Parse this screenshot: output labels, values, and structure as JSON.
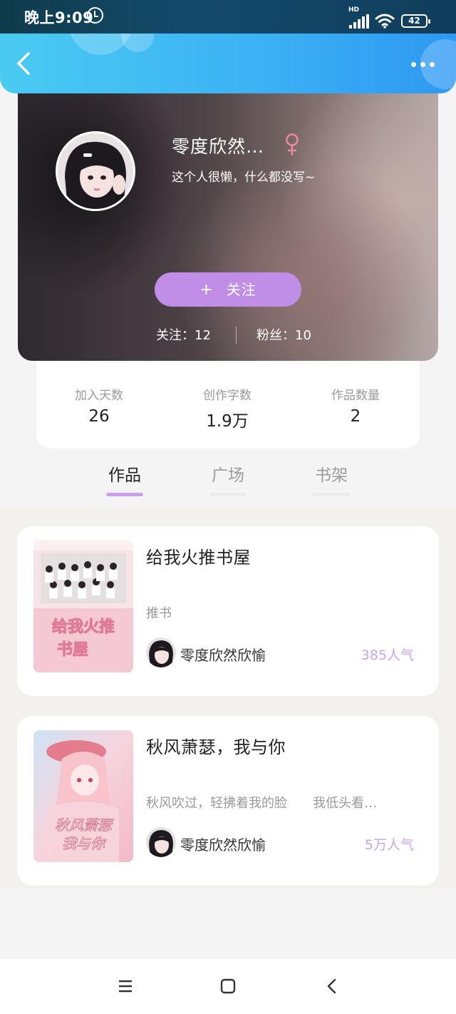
{
  "status_bar": {
    "time": "晚上9:09",
    "network": "HD",
    "battery": "42"
  },
  "profile": {
    "nickname": "零度欣然…",
    "bio": "这个人很懒，什么都没写~",
    "follow_plus": "+",
    "follow_label": "关注",
    "following_label": "关注：12",
    "followers_label": "粉丝：10"
  },
  "stats": [
    {
      "label": "加入天数",
      "value": "26"
    },
    {
      "label": "创作字数",
      "value": "1.9万"
    },
    {
      "label": "作品数量",
      "value": "2"
    }
  ],
  "tabs": [
    {
      "label": "作品",
      "active": true
    },
    {
      "label": "广场",
      "active": false
    },
    {
      "label": "书架",
      "active": false
    }
  ],
  "works": [
    {
      "title": "给我火推书屋",
      "description": "推书",
      "author": "零度欣然欣愉",
      "popularity": "385人气",
      "cover_text": "给我火推书屋"
    },
    {
      "title": "秋风萧瑟，我与你",
      "description": "秋风吹过，轻拂着我的脸　　我低头看…",
      "author": "零度欣然欣愉",
      "popularity": "5万人气",
      "cover_text": "秋风萧瑟我与你"
    }
  ],
  "colors": {
    "header_gradient_start": "#49cbf2",
    "header_gradient_end": "#2e98f2",
    "accent_purple": "#c08ee6",
    "popularity_purple": "#c9a6eb"
  },
  "icons": [
    "alarm-icon",
    "signal-icon",
    "wifi-icon",
    "battery-icon",
    "back-arrow-icon",
    "more-dots-icon",
    "female-gender-icon",
    "menu-icon",
    "home-icon",
    "nav-back-icon"
  ]
}
